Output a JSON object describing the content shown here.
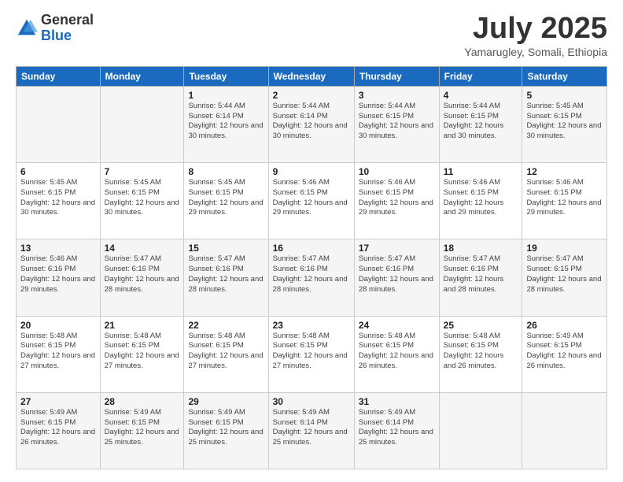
{
  "logo": {
    "general": "General",
    "blue": "Blue"
  },
  "header": {
    "month": "July 2025",
    "location": "Yamarugley, Somali, Ethiopia"
  },
  "days_of_week": [
    "Sunday",
    "Monday",
    "Tuesday",
    "Wednesday",
    "Thursday",
    "Friday",
    "Saturday"
  ],
  "weeks": [
    [
      {
        "day": "",
        "info": ""
      },
      {
        "day": "",
        "info": ""
      },
      {
        "day": "1",
        "info": "Sunrise: 5:44 AM\nSunset: 6:14 PM\nDaylight: 12 hours and 30 minutes."
      },
      {
        "day": "2",
        "info": "Sunrise: 5:44 AM\nSunset: 6:14 PM\nDaylight: 12 hours and 30 minutes."
      },
      {
        "day": "3",
        "info": "Sunrise: 5:44 AM\nSunset: 6:15 PM\nDaylight: 12 hours and 30 minutes."
      },
      {
        "day": "4",
        "info": "Sunrise: 5:44 AM\nSunset: 6:15 PM\nDaylight: 12 hours and 30 minutes."
      },
      {
        "day": "5",
        "info": "Sunrise: 5:45 AM\nSunset: 6:15 PM\nDaylight: 12 hours and 30 minutes."
      }
    ],
    [
      {
        "day": "6",
        "info": "Sunrise: 5:45 AM\nSunset: 6:15 PM\nDaylight: 12 hours and 30 minutes."
      },
      {
        "day": "7",
        "info": "Sunrise: 5:45 AM\nSunset: 6:15 PM\nDaylight: 12 hours and 30 minutes."
      },
      {
        "day": "8",
        "info": "Sunrise: 5:45 AM\nSunset: 6:15 PM\nDaylight: 12 hours and 29 minutes."
      },
      {
        "day": "9",
        "info": "Sunrise: 5:46 AM\nSunset: 6:15 PM\nDaylight: 12 hours and 29 minutes."
      },
      {
        "day": "10",
        "info": "Sunrise: 5:46 AM\nSunset: 6:15 PM\nDaylight: 12 hours and 29 minutes."
      },
      {
        "day": "11",
        "info": "Sunrise: 5:46 AM\nSunset: 6:15 PM\nDaylight: 12 hours and 29 minutes."
      },
      {
        "day": "12",
        "info": "Sunrise: 5:46 AM\nSunset: 6:15 PM\nDaylight: 12 hours and 29 minutes."
      }
    ],
    [
      {
        "day": "13",
        "info": "Sunrise: 5:46 AM\nSunset: 6:16 PM\nDaylight: 12 hours and 29 minutes."
      },
      {
        "day": "14",
        "info": "Sunrise: 5:47 AM\nSunset: 6:16 PM\nDaylight: 12 hours and 28 minutes."
      },
      {
        "day": "15",
        "info": "Sunrise: 5:47 AM\nSunset: 6:16 PM\nDaylight: 12 hours and 28 minutes."
      },
      {
        "day": "16",
        "info": "Sunrise: 5:47 AM\nSunset: 6:16 PM\nDaylight: 12 hours and 28 minutes."
      },
      {
        "day": "17",
        "info": "Sunrise: 5:47 AM\nSunset: 6:16 PM\nDaylight: 12 hours and 28 minutes."
      },
      {
        "day": "18",
        "info": "Sunrise: 5:47 AM\nSunset: 6:16 PM\nDaylight: 12 hours and 28 minutes."
      },
      {
        "day": "19",
        "info": "Sunrise: 5:47 AM\nSunset: 6:15 PM\nDaylight: 12 hours and 28 minutes."
      }
    ],
    [
      {
        "day": "20",
        "info": "Sunrise: 5:48 AM\nSunset: 6:15 PM\nDaylight: 12 hours and 27 minutes."
      },
      {
        "day": "21",
        "info": "Sunrise: 5:48 AM\nSunset: 6:15 PM\nDaylight: 12 hours and 27 minutes."
      },
      {
        "day": "22",
        "info": "Sunrise: 5:48 AM\nSunset: 6:15 PM\nDaylight: 12 hours and 27 minutes."
      },
      {
        "day": "23",
        "info": "Sunrise: 5:48 AM\nSunset: 6:15 PM\nDaylight: 12 hours and 27 minutes."
      },
      {
        "day": "24",
        "info": "Sunrise: 5:48 AM\nSunset: 6:15 PM\nDaylight: 12 hours and 26 minutes."
      },
      {
        "day": "25",
        "info": "Sunrise: 5:48 AM\nSunset: 6:15 PM\nDaylight: 12 hours and 26 minutes."
      },
      {
        "day": "26",
        "info": "Sunrise: 5:49 AM\nSunset: 6:15 PM\nDaylight: 12 hours and 26 minutes."
      }
    ],
    [
      {
        "day": "27",
        "info": "Sunrise: 5:49 AM\nSunset: 6:15 PM\nDaylight: 12 hours and 26 minutes."
      },
      {
        "day": "28",
        "info": "Sunrise: 5:49 AM\nSunset: 6:15 PM\nDaylight: 12 hours and 25 minutes."
      },
      {
        "day": "29",
        "info": "Sunrise: 5:49 AM\nSunset: 6:15 PM\nDaylight: 12 hours and 25 minutes."
      },
      {
        "day": "30",
        "info": "Sunrise: 5:49 AM\nSunset: 6:14 PM\nDaylight: 12 hours and 25 minutes."
      },
      {
        "day": "31",
        "info": "Sunrise: 5:49 AM\nSunset: 6:14 PM\nDaylight: 12 hours and 25 minutes."
      },
      {
        "day": "",
        "info": ""
      },
      {
        "day": "",
        "info": ""
      }
    ]
  ]
}
